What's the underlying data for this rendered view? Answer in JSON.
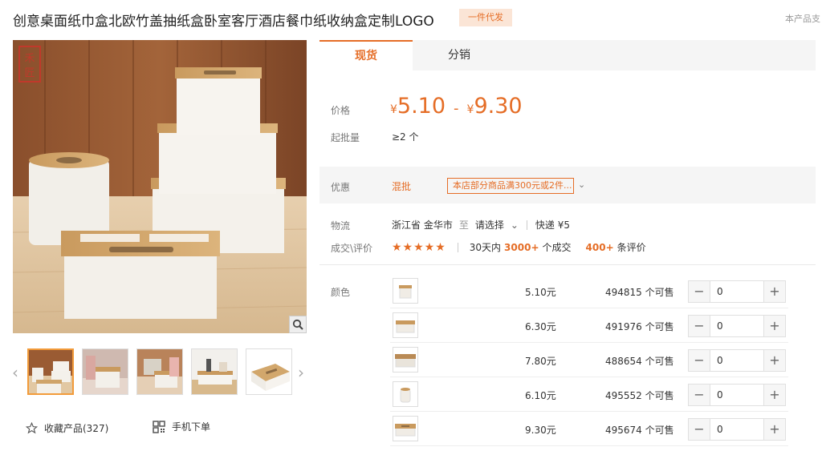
{
  "header": {
    "title": "创意桌面纸巾盒北欧竹盖抽纸盒卧室客厅酒店餐巾纸收纳盒定制LOGO",
    "badge": "一件代发",
    "right_text": "本产品支"
  },
  "gallery": {
    "logo_text": "禾匠",
    "zoom_icon": "magnifier-icon",
    "thumb_count": 5,
    "active_thumb": 1
  },
  "actions": {
    "favorite_label": "收藏产品(327)",
    "mobile_order_label": "手机下单"
  },
  "tabs": [
    {
      "label": "现货",
      "active": true
    },
    {
      "label": "分销",
      "active": false
    }
  ],
  "price": {
    "label": "价格",
    "currency": "¥",
    "low": "5.10",
    "high": "9.30",
    "min_order_label": "起批量",
    "min_order_value": "≥2 个"
  },
  "promo": {
    "label": "优惠",
    "tag": "混批",
    "text": "本店部分商品满300元或2件..."
  },
  "logistics": {
    "label": "物流",
    "origin": "浙江省 金华市",
    "to": "至",
    "select": "请选择",
    "express": "快递 ¥5"
  },
  "deals": {
    "label": "成交\\评价",
    "stars": "★★★★★",
    "prefix": "30天内",
    "count": "3000+",
    "count_suffix": "个成交",
    "reviews": "400+",
    "reviews_suffix": "条评价"
  },
  "sku": {
    "label": "颜色",
    "rows": [
      {
        "price": "5.10元",
        "stock": "494815 个可售",
        "qty": "0"
      },
      {
        "price": "6.30元",
        "stock": "491976 个可售",
        "qty": "0"
      },
      {
        "price": "7.80元",
        "stock": "488654 个可售",
        "qty": "0"
      },
      {
        "price": "6.10元",
        "stock": "495552 个可售",
        "qty": "0"
      },
      {
        "price": "9.30元",
        "stock": "495674 个可售",
        "qty": "0"
      }
    ]
  },
  "colors": {
    "accent": "#e56d26",
    "wood": "#c9a06a",
    "box_white": "#f3f0ea"
  }
}
